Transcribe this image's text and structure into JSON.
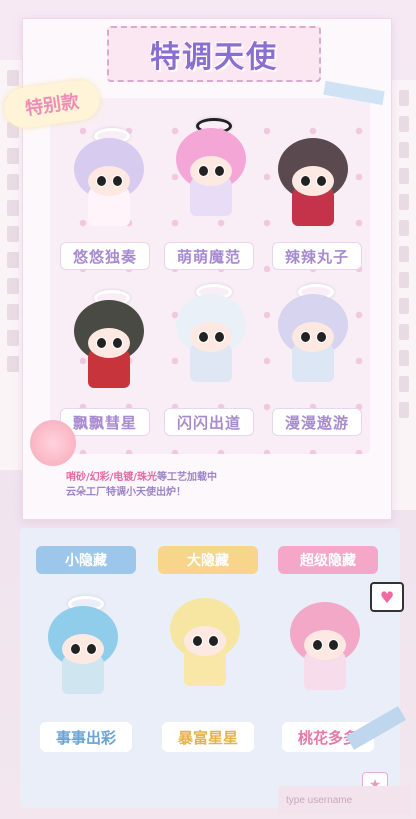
{
  "title": "特调天使",
  "badge": "特别款",
  "figures": [
    {
      "name": "悠悠独奏",
      "head": "#d7ccf0",
      "body": "#fff4f9"
    },
    {
      "name": "萌萌魔范",
      "head": "#f4a6d6",
      "body": "#e9dcf6"
    },
    {
      "name": "辣辣丸子",
      "head": "#5a4a4f",
      "body": "#c4334a"
    },
    {
      "name": "飘飘彗星",
      "head": "#4a4a45",
      "body": "#c8343c"
    },
    {
      "name": "闪闪出道",
      "head": "#e9f0f8",
      "body": "#dfe7f5"
    },
    {
      "name": "漫漫遨游",
      "head": "#d7d4f0",
      "body": "#dde6f5"
    }
  ],
  "description": {
    "line1_kw": "哨砂/幻彩/电镀/珠光",
    "line1_rest": "等工艺加载中",
    "line2": "云朵工厂特调小天使出炉！"
  },
  "hidden": [
    {
      "tag": "小隐藏",
      "name": "事事出彩",
      "tag_color": "#9cc7ea",
      "text_color": "#6aa3d6",
      "head": "#8fcdea",
      "body": "#cfe6f0"
    },
    {
      "tag": "大隐藏",
      "name": "暴富星星",
      "tag_color": "#f7d58a",
      "text_color": "#e8b24a",
      "head": "#f6e6a2",
      "body": "#f9e7a8"
    },
    {
      "tag": "超级隐藏",
      "name": "桃花多多",
      "tag_color": "#f4a7c9",
      "text_color": "#e47aa8",
      "head": "#f4a8c8",
      "body": "#f7dceb"
    }
  ],
  "username_placeholder": "type username",
  "colors": {
    "accent": "#8b6fd0",
    "pink": "#f08cb6"
  }
}
